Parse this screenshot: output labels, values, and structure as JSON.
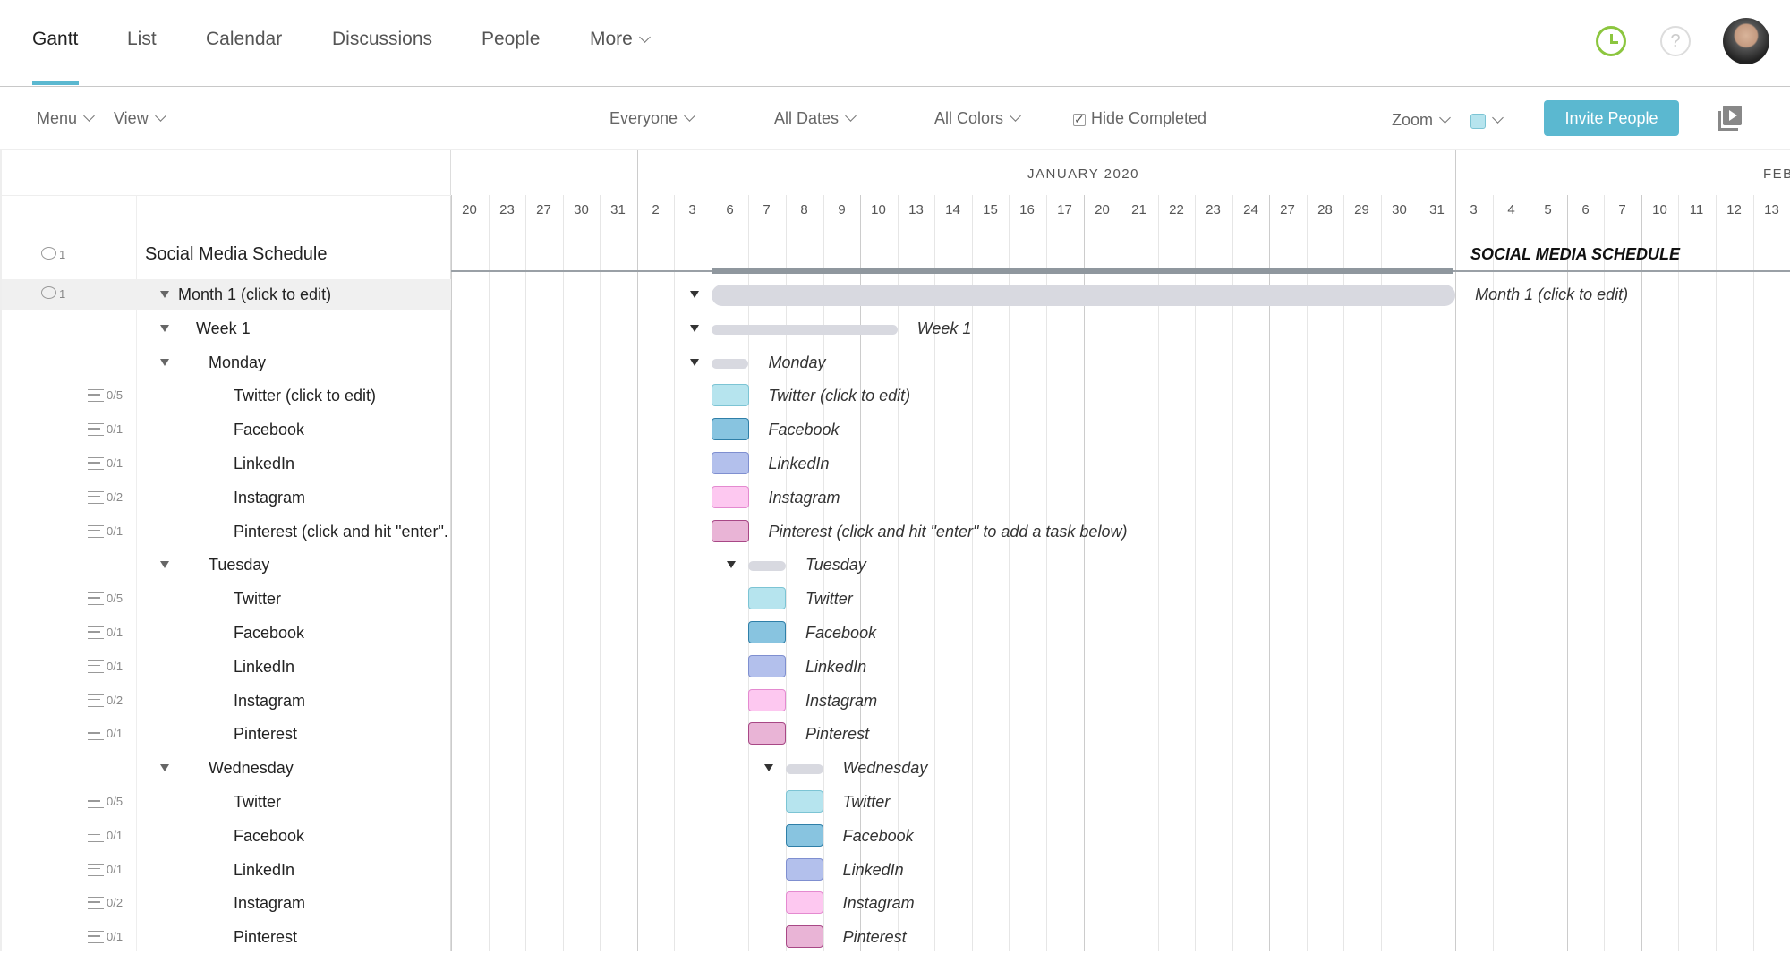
{
  "nav": {
    "tabs": [
      {
        "label": "Gantt",
        "active": true
      },
      {
        "label": "List"
      },
      {
        "label": "Calendar"
      },
      {
        "label": "Discussions"
      },
      {
        "label": "People"
      },
      {
        "label": "More"
      }
    ],
    "icons": [
      "clock-icon",
      "help-icon",
      "avatar"
    ]
  },
  "toolbar": {
    "menu": "Menu",
    "view": "View",
    "everyone": "Everyone",
    "all_dates": "All Dates",
    "all_colors": "All Colors",
    "hide_completed": "Hide Completed",
    "hide_completed_checked": true,
    "zoom": "Zoom",
    "color_swatch": "#b6e4ee",
    "invite": "Invite People"
  },
  "timeline": {
    "months": [
      {
        "label": "",
        "days": [
          20,
          23,
          27,
          30,
          31
        ]
      },
      {
        "label": "",
        "days": [
          2,
          3
        ]
      },
      {
        "label": "JANUARY 2020",
        "days": [
          6,
          7,
          8,
          9,
          10,
          13,
          14,
          15,
          16,
          17,
          20,
          21,
          22,
          23,
          24,
          27,
          28,
          29,
          30,
          31
        ]
      },
      {
        "label": "FEB",
        "days": [
          3,
          4,
          5,
          6,
          7,
          10,
          11,
          12,
          13
        ]
      }
    ]
  },
  "project": {
    "title": "Social Media Schedule",
    "gantt_label": "SOCIAL MEDIA SCHEDULE",
    "comments": "1"
  },
  "colors": {
    "Twitter": {
      "fill": "#b6e4ee",
      "border": "#7cc4d4"
    },
    "Facebook": {
      "fill": "#88c4e0",
      "border": "#2f7fa8"
    },
    "LinkedIn": {
      "fill": "#b3c0ec",
      "border": "#7f8fd0"
    },
    "Instagram": {
      "fill": "#fdc8f0",
      "border": "#e48ad0"
    },
    "Pinterest": {
      "fill": "#e9b4d6",
      "border": "#a84886"
    }
  },
  "rows": [
    {
      "name": "Month 1 (click to edit)",
      "level": 0,
      "type": "group",
      "comments": "1",
      "start": {
        "month": "JANUARY 2020",
        "day": 6
      },
      "end": {
        "month": "JANUARY 2020",
        "day": 31
      }
    },
    {
      "name": "Week 1",
      "level": 1,
      "type": "group",
      "start": {
        "month": "JANUARY 2020",
        "day": 6
      },
      "end": {
        "month": "JANUARY 2020",
        "day": 10
      }
    },
    {
      "name": "Monday",
      "level": 2,
      "type": "group",
      "start": {
        "month": "JANUARY 2020",
        "day": 6
      },
      "end": {
        "month": "JANUARY 2020",
        "day": 6
      }
    },
    {
      "name": "Twitter (click to edit)",
      "gantt_name": "Twitter (click to edit)",
      "level": 3,
      "type": "task",
      "color": "Twitter",
      "checklist": "0/5",
      "start": {
        "month": "JANUARY 2020",
        "day": 6
      }
    },
    {
      "name": "Facebook",
      "level": 3,
      "type": "task",
      "color": "Facebook",
      "checklist": "0/1",
      "start": {
        "month": "JANUARY 2020",
        "day": 6
      }
    },
    {
      "name": "LinkedIn",
      "level": 3,
      "type": "task",
      "color": "LinkedIn",
      "checklist": "0/1",
      "start": {
        "month": "JANUARY 2020",
        "day": 6
      }
    },
    {
      "name": "Instagram",
      "level": 3,
      "type": "task",
      "color": "Instagram",
      "checklist": "0/2",
      "start": {
        "month": "JANUARY 2020",
        "day": 6
      }
    },
    {
      "name": "Pinterest (click and hit \"enter\".",
      "gantt_name": "Pinterest (click and hit \"enter\" to add a task below)",
      "level": 3,
      "type": "task",
      "color": "Pinterest",
      "checklist": "0/1",
      "start": {
        "month": "JANUARY 2020",
        "day": 6
      }
    },
    {
      "name": "Tuesday",
      "level": 2,
      "type": "group",
      "start": {
        "month": "JANUARY 2020",
        "day": 7
      },
      "end": {
        "month": "JANUARY 2020",
        "day": 7
      }
    },
    {
      "name": "Twitter",
      "level": 3,
      "type": "task",
      "color": "Twitter",
      "checklist": "0/5",
      "start": {
        "month": "JANUARY 2020",
        "day": 7
      }
    },
    {
      "name": "Facebook",
      "level": 3,
      "type": "task",
      "color": "Facebook",
      "checklist": "0/1",
      "start": {
        "month": "JANUARY 2020",
        "day": 7
      }
    },
    {
      "name": "LinkedIn",
      "level": 3,
      "type": "task",
      "color": "LinkedIn",
      "checklist": "0/1",
      "start": {
        "month": "JANUARY 2020",
        "day": 7
      }
    },
    {
      "name": "Instagram",
      "level": 3,
      "type": "task",
      "color": "Instagram",
      "checklist": "0/2",
      "start": {
        "month": "JANUARY 2020",
        "day": 7
      }
    },
    {
      "name": "Pinterest",
      "level": 3,
      "type": "task",
      "color": "Pinterest",
      "checklist": "0/1",
      "start": {
        "month": "JANUARY 2020",
        "day": 7
      }
    },
    {
      "name": "Wednesday",
      "level": 2,
      "type": "group",
      "start": {
        "month": "JANUARY 2020",
        "day": 8
      },
      "end": {
        "month": "JANUARY 2020",
        "day": 8
      }
    },
    {
      "name": "Twitter",
      "level": 3,
      "type": "task",
      "color": "Twitter",
      "checklist": "0/5",
      "start": {
        "month": "JANUARY 2020",
        "day": 8
      }
    },
    {
      "name": "Facebook",
      "level": 3,
      "type": "task",
      "color": "Facebook",
      "checklist": "0/1",
      "start": {
        "month": "JANUARY 2020",
        "day": 8
      }
    },
    {
      "name": "LinkedIn",
      "level": 3,
      "type": "task",
      "color": "LinkedIn",
      "checklist": "0/1",
      "start": {
        "month": "JANUARY 2020",
        "day": 8
      }
    },
    {
      "name": "Instagram",
      "level": 3,
      "type": "task",
      "color": "Instagram",
      "checklist": "0/2",
      "start": {
        "month": "JANUARY 2020",
        "day": 8
      }
    },
    {
      "name": "Pinterest",
      "level": 3,
      "type": "task",
      "color": "Pinterest",
      "checklist": "0/1",
      "start": {
        "month": "JANUARY 2020",
        "day": 8
      }
    }
  ]
}
